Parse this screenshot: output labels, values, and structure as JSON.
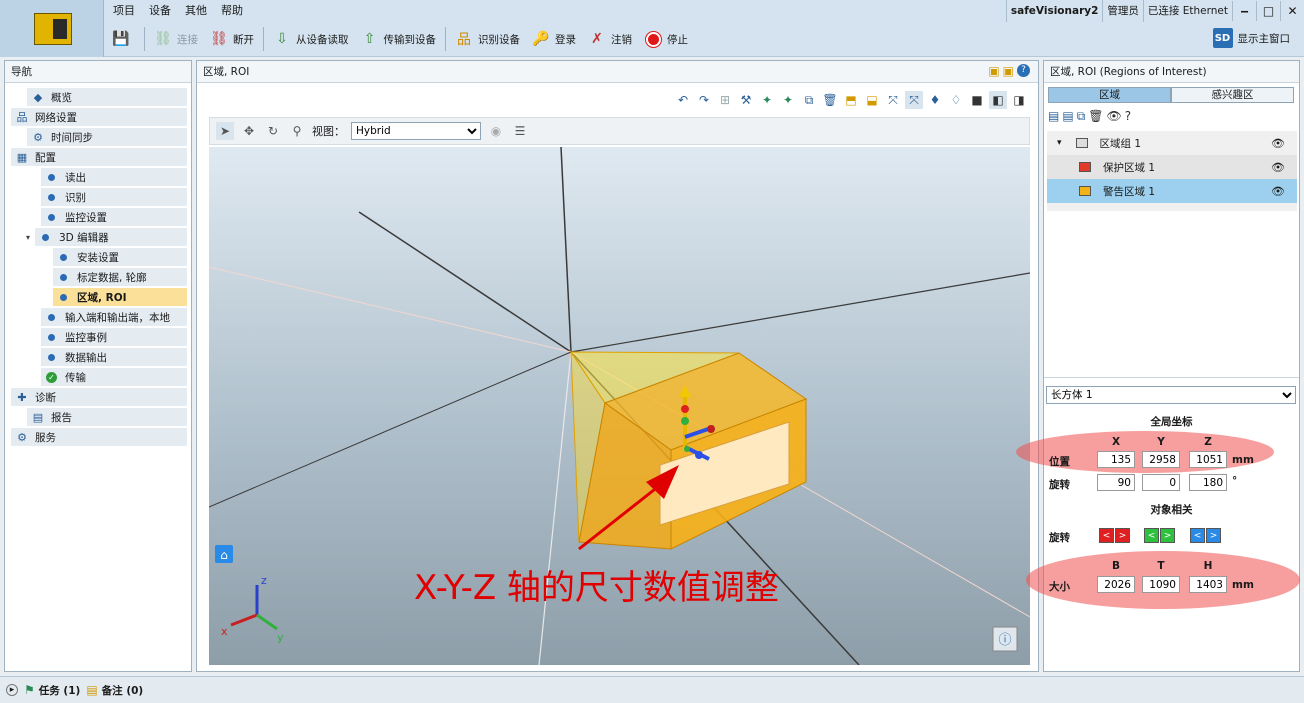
{
  "menu": [
    "项目",
    "设备",
    "其他",
    "帮助"
  ],
  "toolbar": {
    "save": "",
    "connect": "连接",
    "disconnect": "断开",
    "read_device": "从设备读取",
    "transfer_device": "传输到设备",
    "identify_device": "识别设备",
    "login": "登录",
    "logout": "注销",
    "stop": "停止"
  },
  "status": {
    "device": "safeVisionary2",
    "user": "管理员",
    "connection": "已连接 Ethernet",
    "show_main": "显示主窗口",
    "sd_badge": "SD"
  },
  "nav": {
    "title": "导航",
    "items": [
      {
        "label": "概览",
        "icon": "overview-icon",
        "glyph": "◆"
      },
      {
        "label": "网络设置",
        "icon": "network-icon",
        "glyph": "品",
        "expand": "▸"
      },
      {
        "label": "时间同步",
        "icon": "time-sync-icon",
        "glyph": "⚙"
      },
      {
        "label": "配置",
        "icon": "config-icon",
        "glyph": "▦",
        "expand": "▾"
      },
      {
        "label": "读出",
        "icon": "step-dot-icon"
      },
      {
        "label": "识别",
        "icon": "step-dot-icon"
      },
      {
        "label": "监控设置",
        "icon": "step-dot-icon"
      },
      {
        "label": "3D 编辑器",
        "icon": "step-dot-icon",
        "expand": "▾"
      },
      {
        "label": "安装设置",
        "icon": "step-dot-icon"
      },
      {
        "label": "标定数据, 轮廓",
        "icon": "step-dot-icon"
      },
      {
        "label": "区域, ROI",
        "icon": "step-dot-icon"
      },
      {
        "label": "输入端和输出端，本地",
        "icon": "step-dot-icon"
      },
      {
        "label": "监控事例",
        "icon": "step-dot-icon"
      },
      {
        "label": "数据输出",
        "icon": "step-dot-icon"
      },
      {
        "label": "传输",
        "icon": "check-icon"
      },
      {
        "label": "诊断",
        "icon": "diagnosis-icon",
        "glyph": "✚",
        "expand": "▸"
      },
      {
        "label": "报告",
        "icon": "report-icon",
        "glyph": "▤"
      },
      {
        "label": "服务",
        "icon": "service-icon",
        "glyph": "⚙",
        "expand": "▸"
      }
    ]
  },
  "editor": {
    "title": "区域, ROI",
    "view_label": "视图：",
    "view_value": "Hybrid",
    "annotation": "X-Y-Z 轴的尺寸数值调整",
    "axes": {
      "x": "x",
      "y": "y",
      "z": "z"
    }
  },
  "roi": {
    "title": "区域, ROI (Regions of Interest)",
    "tabs": [
      "区域",
      "感兴趣区"
    ],
    "tree": [
      {
        "label": "区域组 1",
        "expand": "▾"
      },
      {
        "label": "保护区域 1"
      },
      {
        "label": "警告区域 1"
      }
    ],
    "shape": "长方体 1",
    "global_title": "全局坐标",
    "position_label": "位置",
    "rotation_label": "旋转",
    "col_x": "X",
    "col_y": "Y",
    "col_z": "Z",
    "pos_x": "135",
    "pos_y": "2958",
    "pos_z": "1051",
    "rot_x": "90",
    "rot_y": "0",
    "rot_z": "180",
    "unit_mm": "mm",
    "unit_deg": "°",
    "object_title": "对象相关",
    "obj_rotation_label": "旋转",
    "size_label": "大小",
    "col_b": "B",
    "col_t": "T",
    "col_h": "H",
    "size_b": "2026",
    "size_t": "1090",
    "size_h": "1403",
    "arrow_left": "<",
    "arrow_right": ">"
  },
  "bottom": {
    "tasks": "任务 (1)",
    "notes": "备注 (0)"
  },
  "colors": {
    "accent_red": "#e00000",
    "rot_x": "#e02020",
    "rot_y": "#30c040",
    "rot_z": "#2a8ae8"
  }
}
